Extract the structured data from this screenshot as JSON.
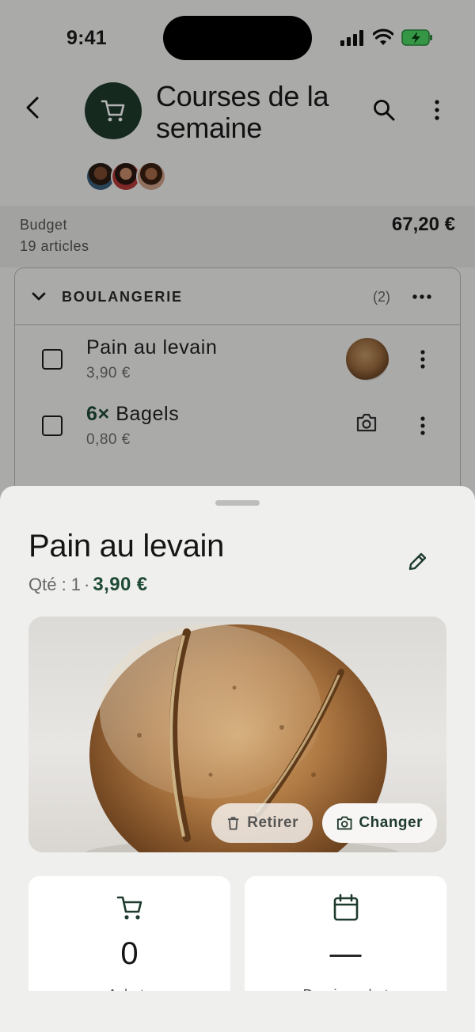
{
  "status_bar": {
    "time": "9:41"
  },
  "header": {
    "title": "Courses de la semaine",
    "icons": [
      "back-arrow-icon",
      "cart-icon",
      "search-icon",
      "more-vertical-icon"
    ],
    "avatars": [
      "avatar-1",
      "avatar-2",
      "avatar-3"
    ]
  },
  "budget": {
    "label": "Budget",
    "count": "19 articles",
    "amount": "67,20 €"
  },
  "category": {
    "name": "BOULANGERIE",
    "count": "(2)",
    "items": [
      {
        "name": "Pain au levain",
        "price": "3,90 €",
        "qty": "",
        "has_photo": true
      },
      {
        "name": "Bagels",
        "price": "0,80 €",
        "qty": "6×",
        "has_photo": false
      }
    ]
  },
  "sheet": {
    "title": "Pain au levain",
    "qty_label": "Qté : 1",
    "separator": "·",
    "price": "3,90 €",
    "remove_label": "Retirer",
    "change_label": "Changer",
    "stats": [
      {
        "icon": "cart-icon",
        "value": "0",
        "label": "Achats"
      },
      {
        "icon": "calendar-icon",
        "value": "—",
        "label": "Dernier achat"
      }
    ]
  },
  "colors": {
    "accent": "#1f3b2d",
    "price_green": "#1f4a36",
    "sheet_bg": "#efefee"
  }
}
